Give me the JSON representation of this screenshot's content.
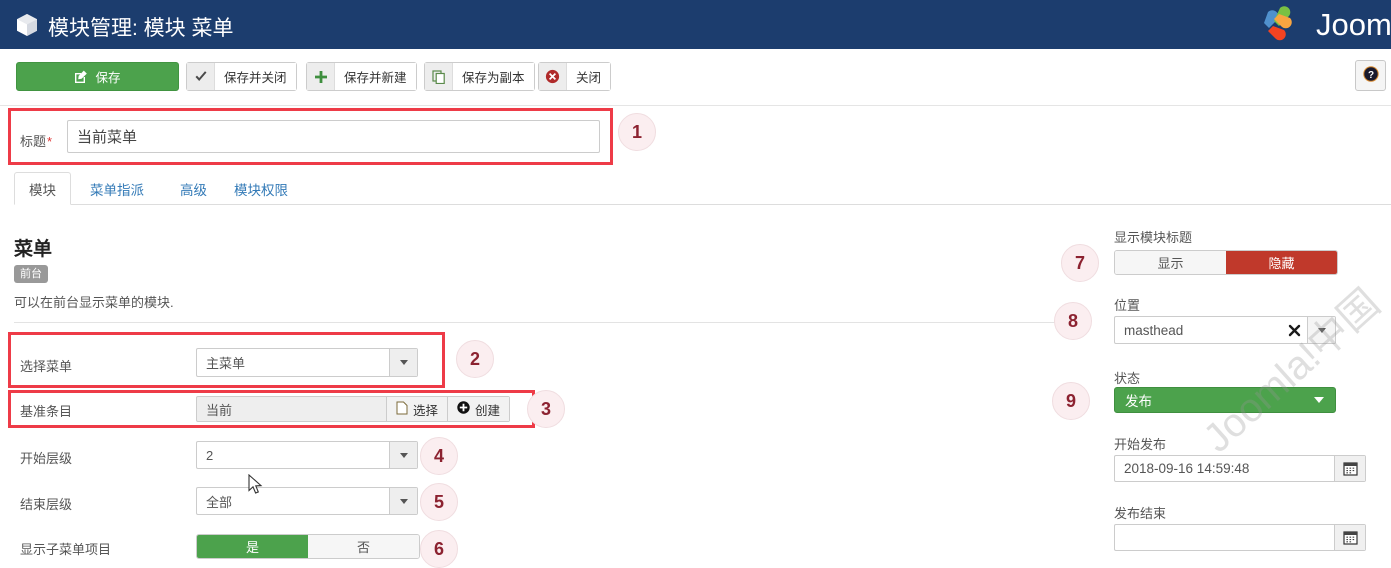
{
  "header": {
    "title": "模块管理: 模块 菜单",
    "cube_icon": "cube-icon",
    "logo_text": "Joom"
  },
  "toolbar": {
    "save": "保存",
    "save_close": "保存并关闭",
    "save_new": "保存并新建",
    "save_copy": "保存为副本",
    "close": "关闭",
    "help_icon": "help-question-icon",
    "save_color": "#4ca24c"
  },
  "title_row": {
    "label": "标题",
    "required_mark": "*",
    "value": "当前菜单",
    "marker": "1"
  },
  "tabs": [
    {
      "label": "模块",
      "active": true
    },
    {
      "label": "菜单指派",
      "active": false
    },
    {
      "label": "高级",
      "active": false
    },
    {
      "label": "模块权限",
      "active": false
    }
  ],
  "module": {
    "name": "菜单",
    "badge": "前台",
    "description": "可以在前台显示菜单的模块."
  },
  "form": {
    "select_menu": {
      "label": "选择菜单",
      "value": "主菜单",
      "marker": "2"
    },
    "base_item": {
      "label": "基准条目",
      "value": "当前",
      "select_btn": "选择",
      "create_btn": "创建",
      "marker": "3"
    },
    "start_level": {
      "label": "开始层级",
      "value": "2",
      "marker": "4"
    },
    "end_level": {
      "label": "结束层级",
      "value": "全部",
      "marker": "5"
    },
    "show_sub": {
      "label": "显示子菜单项目",
      "yes": "是",
      "no": "否",
      "selected": "是",
      "marker": "6"
    }
  },
  "sidebar": {
    "show_title": {
      "label": "显示模块标题",
      "show": "显示",
      "hide": "隐藏",
      "selected": "隐藏",
      "marker": "7",
      "hide_color": "#c0392b"
    },
    "position": {
      "label": "位置",
      "value": "masthead",
      "clear_icon": "clear-x-icon",
      "marker": "8"
    },
    "status": {
      "label": "状态",
      "value": "发布",
      "marker": "9",
      "color": "#4ca24c"
    },
    "publish_start": {
      "label": "开始发布",
      "value": "2018-09-16 14:59:48",
      "calendar_icon": "calendar-icon"
    },
    "publish_end": {
      "label": "发布结束",
      "value": "",
      "calendar_icon": "calendar-icon"
    }
  },
  "watermark": "Joomla!中国",
  "highlight_color": "#ee3b47"
}
